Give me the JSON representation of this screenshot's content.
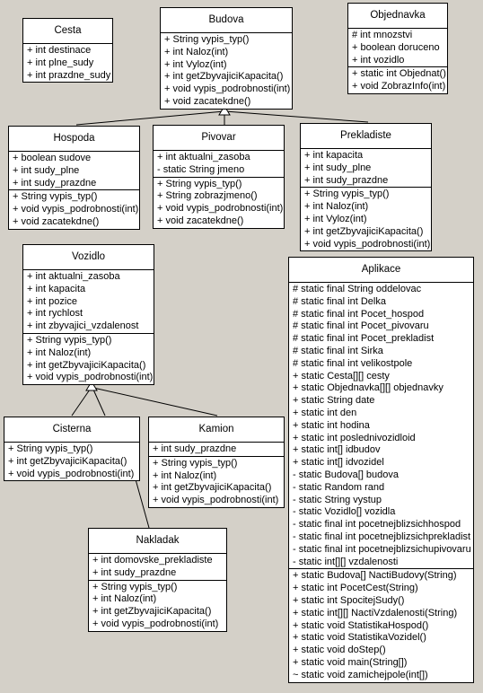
{
  "classes": [
    {
      "name": "Cesta",
      "attributes": [
        "+ int destinace",
        "+ int plne_sudy",
        "+ int prazdne_sudy"
      ],
      "methods": []
    },
    {
      "name": "Budova",
      "attributes": [],
      "methods": [
        "+ String vypis_typ()",
        "+ int Naloz(int)",
        "+ int Vyloz(int)",
        "+ int getZbyvajiciKapacita()",
        "+ void vypis_podrobnosti(int)",
        "+ void zacatekdne()"
      ]
    },
    {
      "name": "Objednavka",
      "attributes": [
        "# int mnozstvi",
        "+ boolean doruceno",
        "+ int vozidlo"
      ],
      "methods": [
        "+ static int Objednat()",
        "+ void ZobrazInfo(int)"
      ]
    },
    {
      "name": "Hospoda",
      "attributes": [
        "+ boolean sudove",
        "+ int sudy_plne",
        "+ int sudy_prazdne"
      ],
      "methods": [
        "+ String vypis_typ()",
        "+ void vypis_podrobnosti(int)",
        "+ void zacatekdne()"
      ]
    },
    {
      "name": "Pivovar",
      "attributes": [
        "+ int aktualni_zasoba",
        "- static String jmeno"
      ],
      "methods": [
        "+ String vypis_typ()",
        "+ String zobrazjmeno()",
        "+ void vypis_podrobnosti(int)",
        "+ void zacatekdne()"
      ]
    },
    {
      "name": "Prekladiste",
      "attributes": [
        "+ int kapacita",
        "+ int sudy_plne",
        "+ int sudy_prazdne"
      ],
      "methods": [
        "+ String vypis_typ()",
        "+ int Naloz(int)",
        "+ int Vyloz(int)",
        "+ int getZbyvajiciKapacita()",
        "+ void vypis_podrobnosti(int)"
      ]
    },
    {
      "name": "Vozidlo",
      "attributes": [
        "+ int aktualni_zasoba",
        "+ int kapacita",
        "+ int pozice",
        "+ int rychlost",
        "+ int zbyvajici_vzdalenost"
      ],
      "methods": [
        "+ String vypis_typ()",
        "+ int Naloz(int)",
        "+ int getZbyvajiciKapacita()",
        "+ void vypis_podrobnosti(int)"
      ]
    },
    {
      "name": "Aplikace",
      "attributes": [
        "# static final String oddelovac",
        "# static final int Delka",
        "# static final int Pocet_hospod",
        "# static final int Pocet_pivovaru",
        "# static final int Pocet_prekladist",
        "# static final int Sirka",
        "# static final int velikostpole",
        "+ static Cesta[][] cesty",
        "+ static Objednavka[][] objednavky",
        "+ static String date",
        "+ static int den",
        "+ static int hodina",
        "+ static int poslednivozidloid",
        "+ static int[] idbudov",
        "+ static int[] idvozidel",
        "- static Budova[] budova",
        "- static Random rand",
        "- static String vystup",
        "- static Vozidlo[] vozidla",
        "- static final int pocetnejblizsichhospod",
        "- static final int pocetnejblizsichprekladist",
        "- static final int pocetnejblizsichupivovaru",
        "- static int[][] vzdalenosti"
      ],
      "methods": [
        "+ static Budova[] NactiBudovy(String)",
        "+ static int PocetCest(String)",
        "+ static int SpocitejSudy()",
        "+ static int[][] NactiVzdalenosti(String)",
        "+ static void StatistikaHospod()",
        "+ static void StatistikaVozidel()",
        "+ static void doStep()",
        "+ static void main(String[])",
        "~ static void zamichejpole(int[])"
      ]
    },
    {
      "name": "Cisterna",
      "attributes": [],
      "methods": [
        "+ String vypis_typ()",
        "+ int getZbyvajiciKapacita()",
        "+ void vypis_podrobnosti(int)"
      ]
    },
    {
      "name": "Kamion",
      "attributes": [
        "+ int sudy_prazdne"
      ],
      "methods": [
        "+ String vypis_typ()",
        "+ int Naloz(int)",
        "+ int getZbyvajiciKapacita()",
        "+ void vypis_podrobnosti(int)"
      ]
    },
    {
      "name": "Nakladak",
      "attributes": [
        "+ int domovske_prekladiste",
        "+ int sudy_prazdne"
      ],
      "methods": [
        "+ String vypis_typ()",
        "+ int Naloz(int)",
        "+ int getZbyvajiciKapacita()",
        "+ void vypis_podrobnosti(int)"
      ]
    }
  ],
  "relations": [
    {
      "type": "generalization",
      "from": "Hospoda",
      "to": "Budova"
    },
    {
      "type": "generalization",
      "from": "Pivovar",
      "to": "Budova"
    },
    {
      "type": "generalization",
      "from": "Prekladiste",
      "to": "Budova"
    },
    {
      "type": "generalization",
      "from": "Cisterna",
      "to": "Vozidlo"
    },
    {
      "type": "generalization",
      "from": "Kamion",
      "to": "Vozidlo"
    },
    {
      "type": "association",
      "from": "Nakladak",
      "to": "Cisterna"
    }
  ],
  "colors": {
    "background": "#d4d0c8",
    "box": "#ffffff",
    "line": "#000000"
  }
}
